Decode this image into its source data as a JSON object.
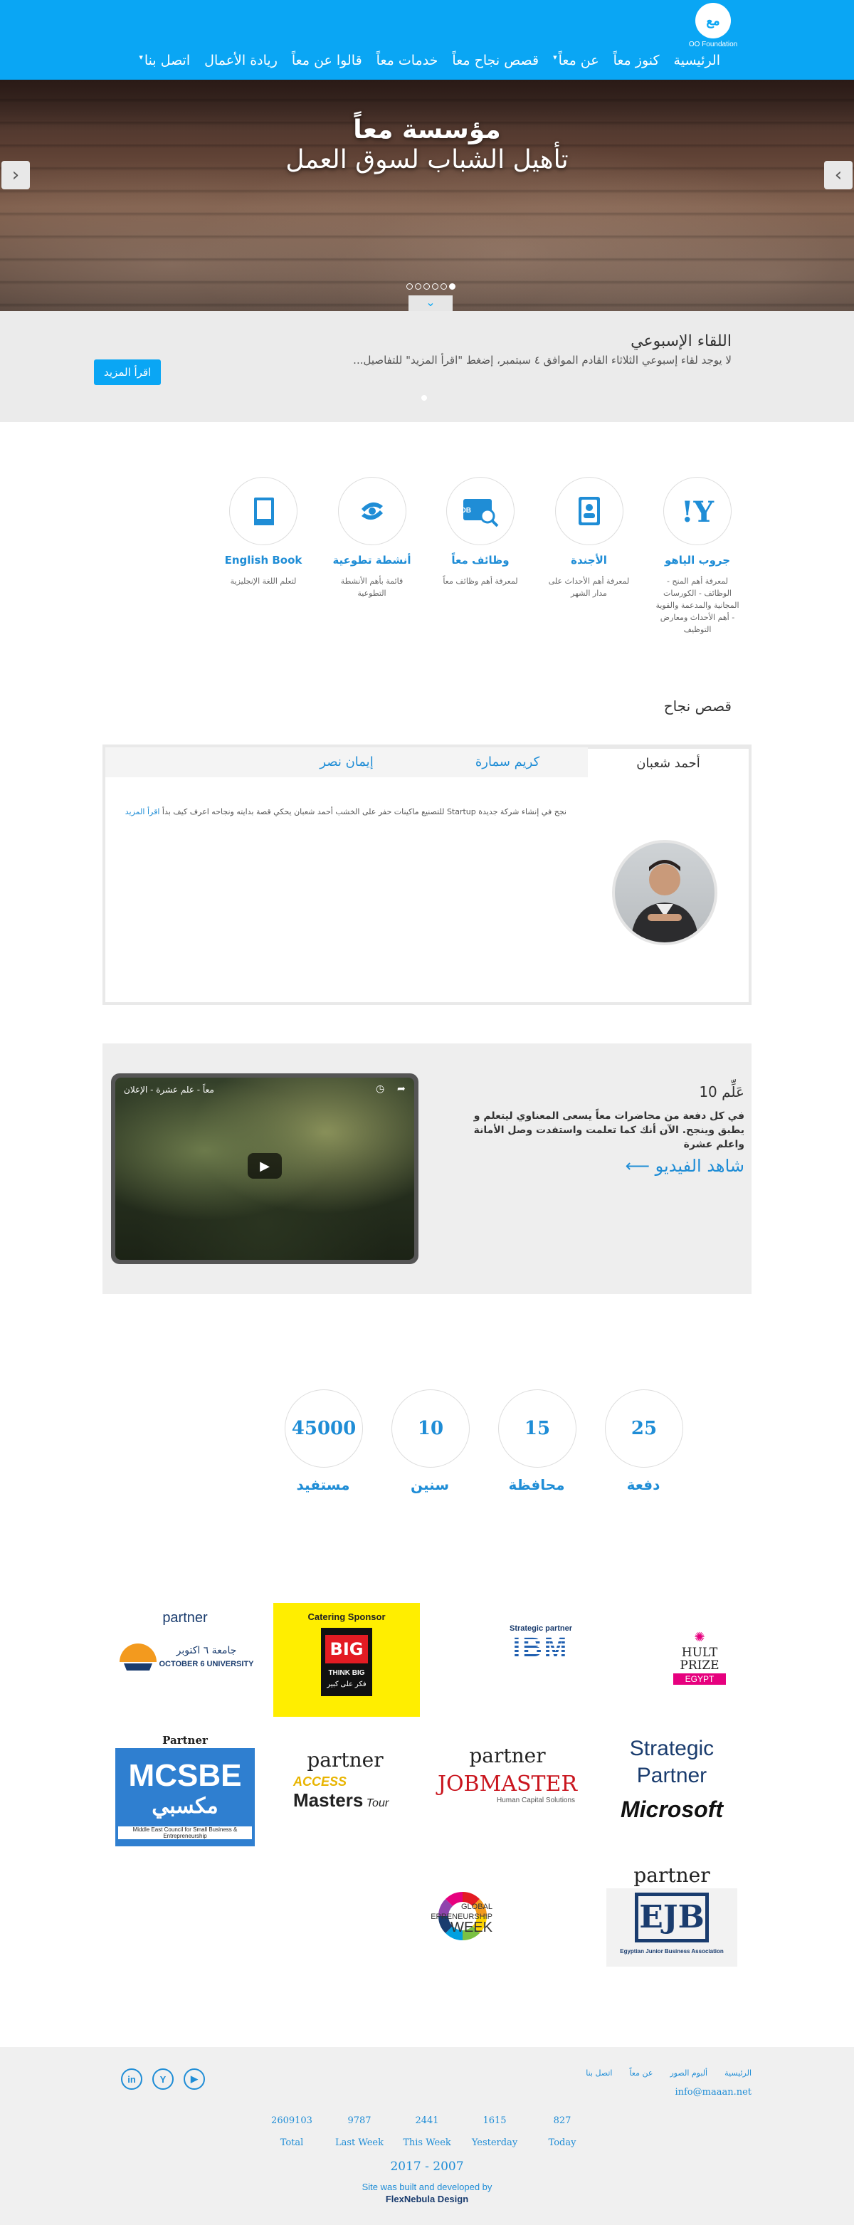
{
  "header": {
    "logo_text": "OO Foundation",
    "logo_mark": "مع",
    "nav": [
      {
        "label": "الرئيسية",
        "caret": ""
      },
      {
        "label": "كنوز معاً",
        "caret": ""
      },
      {
        "label": "عن معاً",
        "caret": "▾"
      },
      {
        "label": "قصص نجاح معاً",
        "caret": ""
      },
      {
        "label": "خدمات معاً",
        "caret": ""
      },
      {
        "label": "قالوا عن معاً",
        "caret": ""
      },
      {
        "label": "ريادة الأعمال",
        "caret": ""
      },
      {
        "label": "اتصل بنا",
        "caret": "▾"
      }
    ]
  },
  "hero": {
    "title": "مؤسسة معاً",
    "subtitle": "تأهيل الشباب لسوق العمل",
    "prev": "‹",
    "next": "›",
    "tab_icon": "⌄",
    "slides": 6,
    "active_slide": 6
  },
  "weekly": {
    "title": "اللقاء الإسبوعي",
    "text": "لا يوجد لقاء إسبوعي الثلاثاء القادم الموافق ٤ سبتمبر، إضغط \"اقرأ المزيد\" للتفاصيل...",
    "button": "اقرأ المزيد"
  },
  "features": [
    {
      "title": "جروب الياهو",
      "desc": "لمعرفة أهم المنح - الوظائف - الكورسات المجانية والمدعمة والقوية - أهم الأحداث ومعارض التوظيف",
      "icon": "yahoo-icon"
    },
    {
      "title": "الأجندة",
      "desc": "لمعرفة أهم الأحداث على مدار الشهر",
      "icon": "agenda-icon"
    },
    {
      "title": "وظائف معاً",
      "desc": "لمعرفة أهم وظائف معاً",
      "icon": "job-search-icon"
    },
    {
      "title": "أنشطة تطوعية",
      "desc": "قائمة بأهم الأنشطة التطوعية",
      "icon": "volunteer-icon"
    },
    {
      "title": "English Book",
      "desc": "لتعلم اللغة الإنجليزية",
      "icon": "book-icon"
    }
  ],
  "stories": {
    "heading": "قصص نجاح",
    "tabs": [
      "أحمد شعبان",
      "كريم سمارة",
      "إيمان نصر"
    ],
    "text": "نجح في إنشاء شركة جديدة Startup للتصنيع ماكينات حفر على الخشب أحمد شعبان يحكي قصة بدايته ونجاحه اعرف كيف بدأ",
    "more": "اقرأ المزيد"
  },
  "video": {
    "heading": "عَلِّم 10",
    "desc": "في كل دفعة من محاضرات معاً يسعى المعناوي ليتعلم و يطبق وينجح. الآن أنك كما تعلمت واستفدت وصل الأمانة واعلم عشرة",
    "link": "شاهد الفيديو",
    "player_title": "معاً - علم عشرة - الإعلان"
  },
  "stats": [
    {
      "value": "25",
      "label": "دفعة"
    },
    {
      "value": "15",
      "label": "محافظة"
    },
    {
      "value": "10",
      "label": "سنين"
    },
    {
      "value": "45000",
      "label": "مستفيد"
    }
  ],
  "partners": {
    "partner_label": "partner",
    "catering": "Catering Sponsor",
    "big_line1": "BIG",
    "big_line2": "THINK BIG",
    "big_line3": "فكر على كبير",
    "strategic": "Strategic partner",
    "ibm": "IBM",
    "hult_line1": "HULT",
    "hult_line2": "PRIZE",
    "hult_line3": "EGYPT",
    "o6u_ar": "جامعة ٦ اكتوبر",
    "o6u_en": "OCTOBER 6 UNIVERSITY",
    "mcsbe_label": "Partner",
    "mcsbe": "MCSBE",
    "mcsbe_ar": "مكسبي",
    "mcsbe_sub": "Middle East Council for Small Business & Entrepreneurship",
    "access_line1": "ACCESS",
    "access_line2": "Masters",
    "access_line3": "Tour",
    "jobmaster": "JOBMASTER",
    "jobmaster_sub": "Human Capital Solutions",
    "strategic_partner_line1": "Strategic",
    "strategic_partner_line2": "Partner",
    "microsoft": "Microsoft",
    "gew_line1": "GLOBAL",
    "gew_line2": "ENTREPRENEURSHIP",
    "gew_line3": "WEEK",
    "ejb": "EJB",
    "ejb_sub": "Egyptian Junior Business Association"
  },
  "footer": {
    "links": [
      "الرئيسية",
      "ألبوم الصور",
      "عن معاً",
      "اتصل بنا"
    ],
    "email": "info@maaan.net",
    "social": [
      "in",
      "Y",
      "▶"
    ],
    "counter": [
      {
        "value": "2609103",
        "label": "Total"
      },
      {
        "value": "9787",
        "label": "Last Week"
      },
      {
        "value": "2441",
        "label": "This Week"
      },
      {
        "value": "1615",
        "label": "Yesterday"
      },
      {
        "value": "827",
        "label": "Today"
      }
    ],
    "years": "2017 - 2007",
    "built_line": "Site was built and developed by",
    "built_by": "FlexNebula Design"
  },
  "colors": {
    "brand_blue": "#0aa6f4",
    "link_blue": "#1f8dd6"
  }
}
